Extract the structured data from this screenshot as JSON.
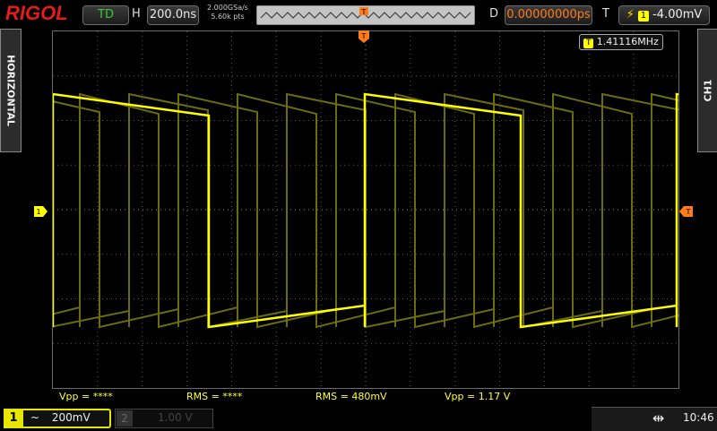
{
  "brand": "RIGOL",
  "topbar": {
    "run_state": "TD",
    "h_label": "H",
    "timebase": "200.0ns",
    "sample_rate": "2.000GSa/s",
    "memory_depth": "5.60k pts",
    "d_label": "D",
    "delay": "0.00000000ps",
    "t_label": "T",
    "trigger_level": "-4.00mV"
  },
  "side": {
    "left_tab": "HORIZONTAL",
    "right_tab": "CH1"
  },
  "frequency_readout": "1.41116MHz",
  "measurements": [
    {
      "text": "Vpp = ****"
    },
    {
      "text": "RMS = ****"
    },
    {
      "text": "RMS = 480mV"
    },
    {
      "text": "Vpp = 1.17 V"
    }
  ],
  "channels": {
    "ch1": {
      "number": "1",
      "coupling": "~",
      "scale": "200mV"
    },
    "ch2": {
      "number": "2",
      "scale": "1.00 V"
    }
  },
  "status": {
    "time": "10:46",
    "usb_icon": "usb-icon"
  },
  "colors": {
    "ch1": "#ffff00",
    "ch1_dim": "#6b6b10",
    "trigger": "#ff7a1a",
    "brand": "#e21b1b"
  },
  "waveform": {
    "type": "square",
    "frequency": "1.41116MHz",
    "vpp": "1.17 V",
    "rms": "480mV"
  }
}
